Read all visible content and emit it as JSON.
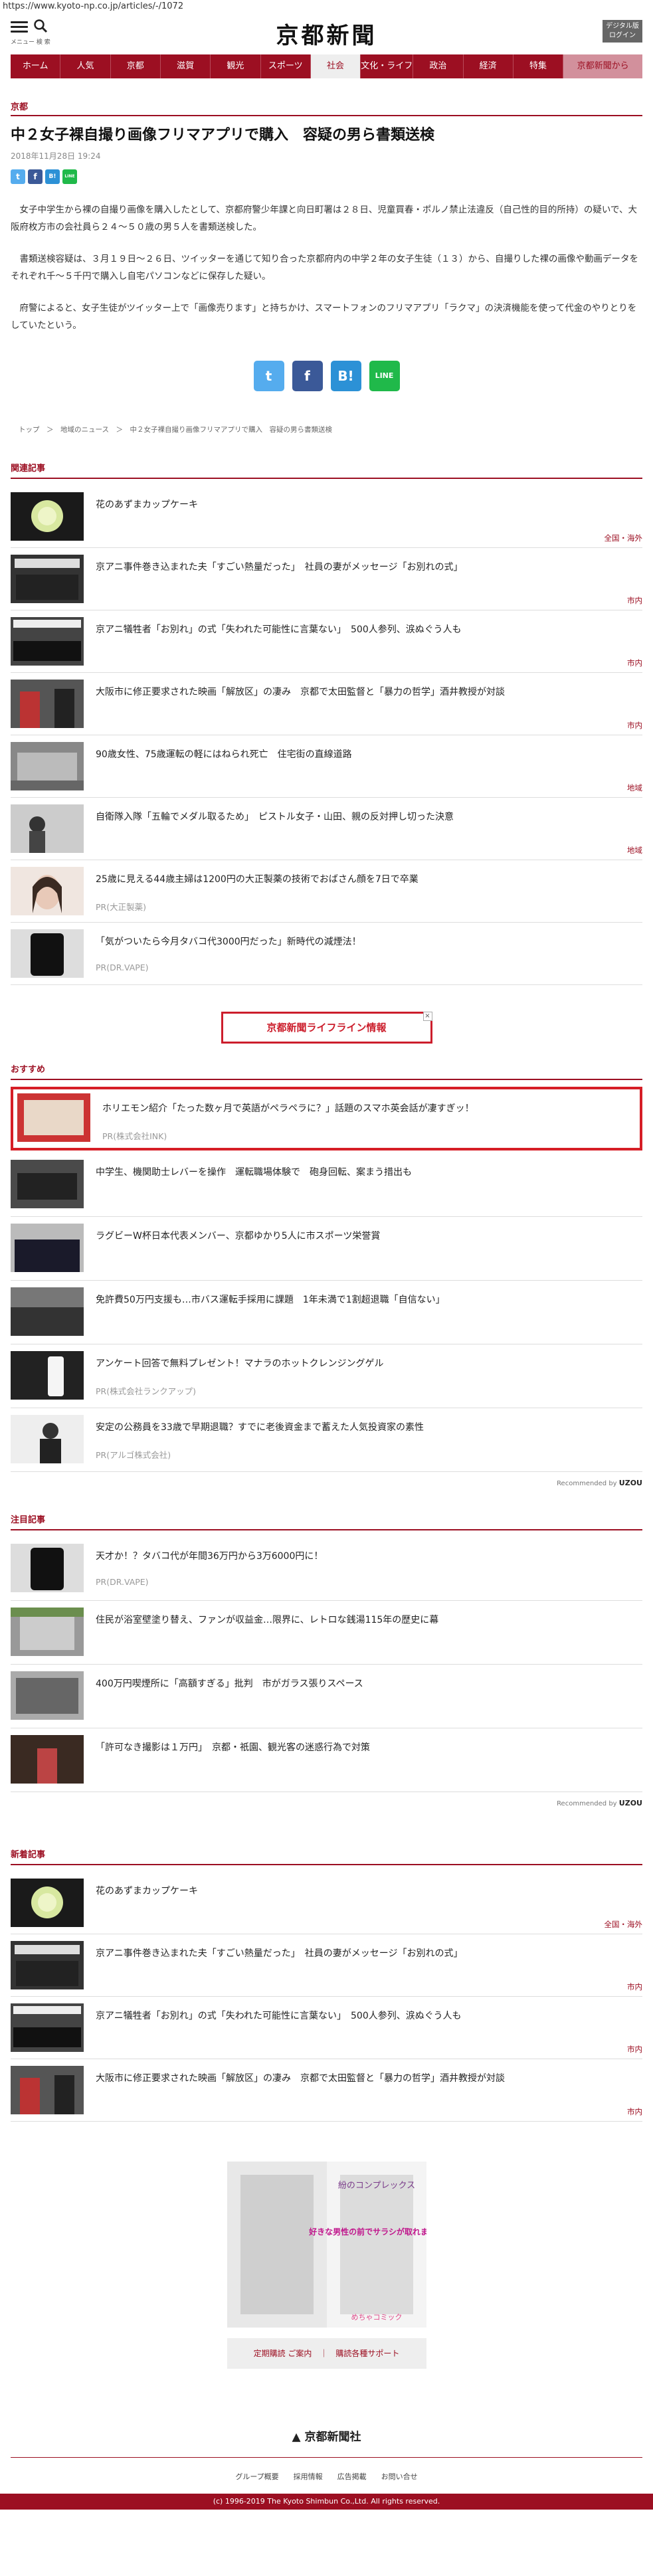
{
  "url": "https://www.kyoto-np.co.jp/articles/-/1072",
  "header": {
    "menu_label": "メニュー 検 索",
    "logo": "京都新聞",
    "digital": "デジタル版 ログイン"
  },
  "nav": [
    "ホーム",
    "人気",
    "京都",
    "滋賀",
    "観光",
    "スポーツ",
    "社会",
    "文化・ライフ",
    "政治",
    "経済",
    "特集",
    "京都新聞から"
  ],
  "article": {
    "category": "京都",
    "title": "中２女子裸自撮り画像フリマアプリで購入　容疑の男ら書類送検",
    "date": "2018年11月28日 19:24",
    "paragraphs": [
      "女子中学生から裸の自撮り画像を購入したとして、京都府警少年課と向日町署は２８日、児童買春・ポルノ禁止法違反（自己性的目的所持）の疑いで、大阪府枚方市の会社員ら２４～５０歳の男５人を書類送検した。",
      "書類送検容疑は、３月１９日～２６日、ツイッターを通じて知り合った京都府内の中学２年の女子生徒（１３）から、自撮りした裸の画像や動画データをそれぞれ千～５千円で購入し自宅パソコンなどに保存した疑い。",
      "府警によると、女子生徒がツイッター上で「画像売ります」と持ちかけ、スマートフォンのフリマアプリ「ラクマ」の決済機能を使って代金のやりとりをしていたという。"
    ],
    "breadcrumb": "トップ　＞　地域のニュース　＞　中２女子裸自撮り画像フリマアプリで購入　容疑の男ら書類送検"
  },
  "share": {
    "twitter": "t",
    "facebook": "f",
    "hatena": "B!",
    "line": "LINE"
  },
  "related": {
    "heading": "関連記事",
    "items": [
      {
        "title": "花のあずまカップケーキ",
        "tag": "全国・海外"
      },
      {
        "title": "京アニ事件巻き込まれた夫「すごい熱量だった」　社員の妻がメッセージ「お別れの式」",
        "tag": "市内"
      },
      {
        "title": "京アニ犠牲者「お別れ」の式「失われた可能性に言葉ない」　500人参列、涙ぬぐう人も",
        "tag": "市内"
      },
      {
        "title": "大阪市に修正要求された映画「解放区」の凄み　京都で太田監督と「暴力の哲学」酒井教授が対談",
        "tag": "市内"
      },
      {
        "title": "90歳女性、75歳運転の軽にはねられ死亡　住宅街の直線道路",
        "tag": "地域"
      },
      {
        "title": "自衛隊入隊「五輪でメダル取るため」　ピストル女子・山田、親の反対押し切った決意",
        "tag": "地域"
      },
      {
        "title": "25歳に見える44歳主婦は1200円の大正製薬の技術でおばさん顔を7日で卒業",
        "pr": "PR(大正製薬)"
      },
      {
        "title": "「気がついたら今月タバコ代3000円だった」新時代の減煙法！",
        "pr": "PR(DR.VAPE)"
      }
    ]
  },
  "banner": "京都新聞ライフライン情報",
  "recommend": {
    "heading": "おすすめ",
    "items": [
      {
        "title": "ホリエモン紹介「たった数ヶ月で英語がペラペラに？」話題のスマホ英会話が凄すぎッ！",
        "pr": "PR(株式会社INK)"
      },
      {
        "title": "中学生、機関助士レバーを操作　運転職場体験で　砲身回転、案まう措出も"
      },
      {
        "title": "ラグビーW杯日本代表メンバー、京都ゆかり5人に市スポーツ栄誉賞"
      },
      {
        "title": "免許費50万円支援も…市バス運転手採用に課題　1年未満で1割超退職「自信ない」"
      },
      {
        "title": "アンケート回答で無料プレゼント！マナラのホットクレンジングゲル",
        "pr": "PR(株式会社ランクアップ)"
      },
      {
        "title": "安定の公務員を33歳で早期退職？すでに老後資金まで蓄えた人気投資家の素性",
        "pr": "PR(アルゴ株式会社)"
      }
    ],
    "powered": "Recommended by",
    "brand": "UZOU"
  },
  "attention": {
    "heading": "注目記事",
    "items": [
      {
        "title": "天才か！？タバコ代が年間36万円から3万6000円に！",
        "pr": "PR(DR.VAPE)"
      },
      {
        "title": "住民が浴室壁塗り替え、ファンが収益金…限界に、レトロな銭湯115年の歴史に幕"
      },
      {
        "title": "400万円喫煙所に「高額すぎる」批判　市がガラス張りスペース"
      },
      {
        "title": "「許可なき撮影は１万円」　京都・祇園、観光客の迷惑行為で対策"
      }
    ],
    "powered": "Recommended by",
    "brand": "UZOU"
  },
  "latest": {
    "heading": "新着記事",
    "items": [
      {
        "title": "花のあずまカップケーキ",
        "tag": "全国・海外"
      },
      {
        "title": "京アニ事件巻き込まれた夫「すごい熱量だった」　社員の妻がメッセージ「お別れの式」",
        "tag": "市内"
      },
      {
        "title": "京アニ犠牲者「お別れ」の式「失われた可能性に言葉ない」　500人参列、涙ぬぐう人も",
        "tag": "市内"
      },
      {
        "title": "大阪市に修正要求された映画「解放区」の凄み　京都で太田監督と「暴力の哲学」酒井教授が対談",
        "tag": "市内"
      }
    ]
  },
  "ad": {
    "text1": "好きな男性の前でサラシが取れました",
    "text2": "紛のコンプレックス",
    "text3": "めちゃコミック"
  },
  "footer": {
    "subscribe": "定期購読 ご案内　｜　購読各種サポート",
    "logo": "京都新聞社",
    "links": "グループ概要　　採用情報　　広告掲載　　お問い合せ",
    "copyright": "(c) 1996-2019 The Kyoto Shimbun Co.,Ltd. All rights reserved."
  }
}
